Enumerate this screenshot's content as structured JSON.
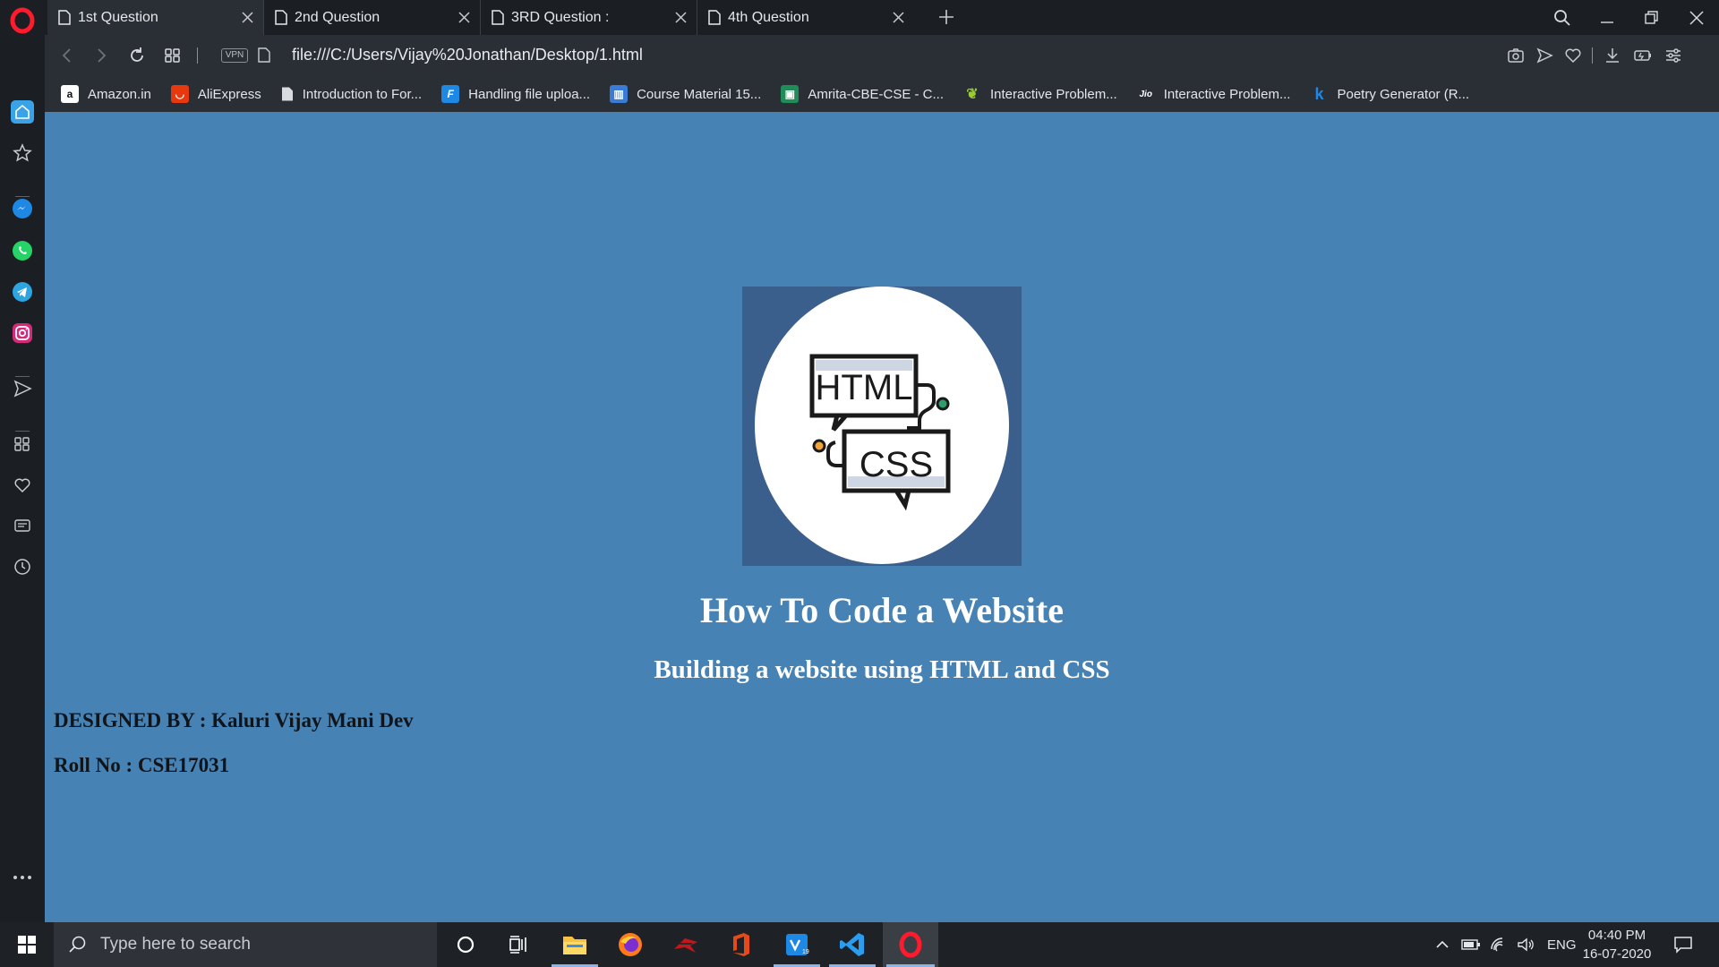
{
  "tabs": [
    {
      "title": "1st Question",
      "active": true
    },
    {
      "title": "2nd Question",
      "active": false
    },
    {
      "title": "3RD Question :",
      "active": false
    },
    {
      "title": "4th Question",
      "active": false
    }
  ],
  "address": {
    "vpn_label": "VPN",
    "url": "file:///C:/Users/Vijay%20Jonathan/Desktop/1.html"
  },
  "bookmarks": [
    {
      "label": "Amazon.in",
      "icon": "amazon-icon",
      "color": "#ffffff"
    },
    {
      "label": "AliExpress",
      "icon": "aliexpress-icon",
      "color": "#e8390e"
    },
    {
      "label": "Introduction to For...",
      "icon": "document-icon",
      "color": "#d8dbe0"
    },
    {
      "label": "Handling file uploa...",
      "icon": "f-icon",
      "color": "#1e88e5"
    },
    {
      "label": "Course Material 15...",
      "icon": "course-icon",
      "color": "#3a7bd5"
    },
    {
      "label": "Amrita-CBE-CSE - C...",
      "icon": "classroom-icon",
      "color": "#1f8c5a"
    },
    {
      "label": "Interactive Problem...",
      "icon": "leaf-icon",
      "color": "#6b8e23"
    },
    {
      "label": "Interactive Problem...",
      "icon": "jio-icon",
      "color": "#ffffff"
    },
    {
      "label": "Poetry Generator (R...",
      "icon": "k-icon",
      "color": "#1e88e5"
    }
  ],
  "page": {
    "title": "How To Code a Website",
    "subtitle": "Building a website using HTML and CSS",
    "designed_by": "DESIGNED BY : Kaluri Vijay Mani Dev",
    "roll_no": "Roll No : CSE17031",
    "background": "#4682b4",
    "hero_text_top": "HTML",
    "hero_text_bottom": "CSS"
  },
  "taskbar": {
    "search_placeholder": "Type here to search",
    "language": "ENG",
    "time": "04:40 PM",
    "date": "16-07-2020"
  }
}
